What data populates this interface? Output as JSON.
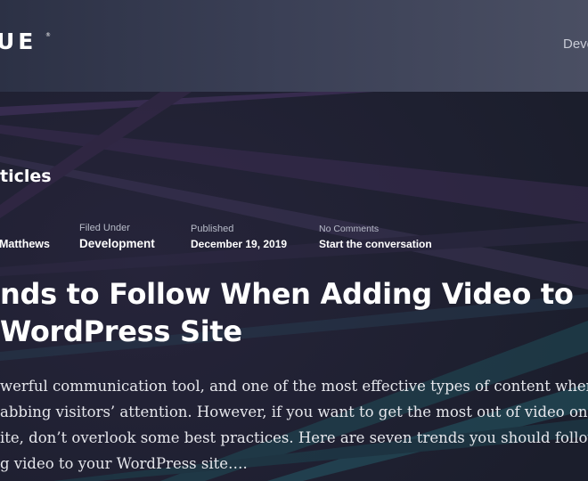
{
  "header": {
    "logo_text": "UE",
    "logo_reg": "®",
    "nav_item": "Deve"
  },
  "section": {
    "title": "ticles"
  },
  "meta": {
    "author": {
      "value": "Matthews"
    },
    "category": {
      "label": "Filed Under",
      "value": "Development"
    },
    "published": {
      "label": "Published",
      "value": "December 19, 2019"
    },
    "comments": {
      "label": "No Comments",
      "value": "Start the conversation"
    }
  },
  "article": {
    "title_line_1": "nds to Follow When Adding Video to",
    "title_line_2": "WordPress Site",
    "excerpt_line_1": "werful communication tool, and one of the most effective types of content when",
    "excerpt_line_2": "abbing visitors’ attention. However, if you want to get the most out of video on yo",
    "excerpt_line_3": "ite, don’t overlook some best practices. Here are seven trends you should follow",
    "excerpt_line_4": "g video to your WordPress site…."
  },
  "colors": {
    "header_start": "#2c3145",
    "header_end": "#4a4f63",
    "background": "#1b1e2c",
    "ray_purple": "#5a3d73",
    "ray_teal": "#2f6b78"
  }
}
